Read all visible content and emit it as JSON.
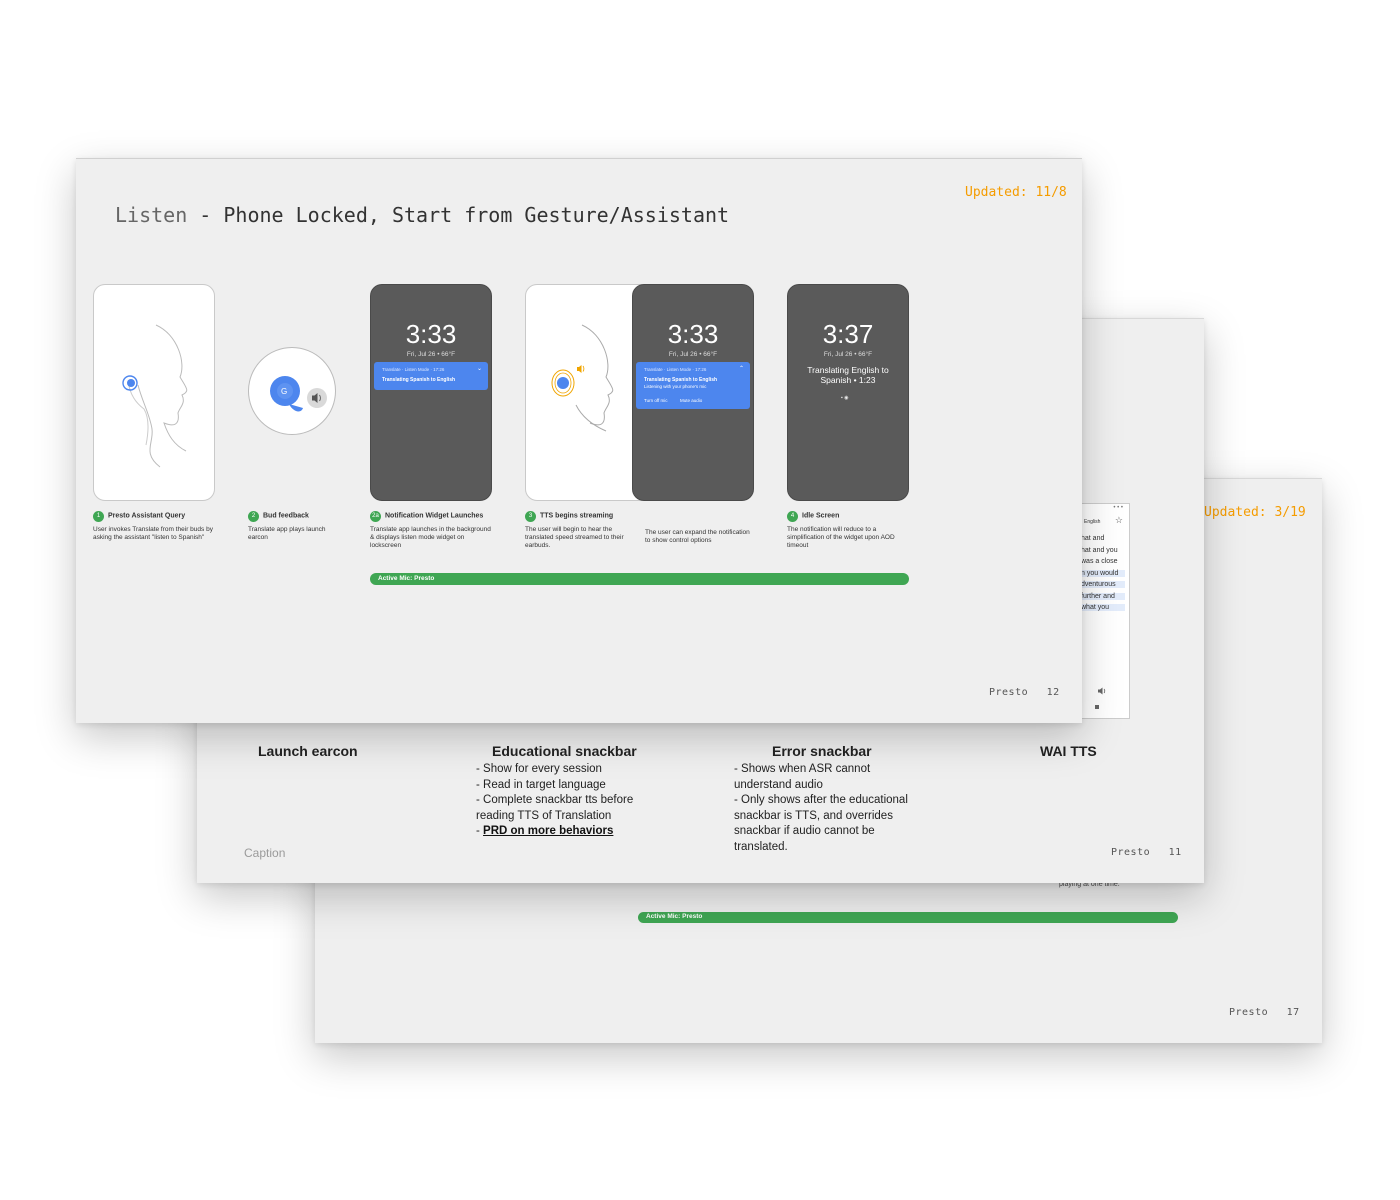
{
  "back_slide": {
    "updated": "Updated: 3/19",
    "note": "playing at one time.",
    "active_mic": "Active Mic: Presto",
    "footer_brand": "Presto",
    "footer_page": "17"
  },
  "middle_slide": {
    "phone_header": "English",
    "phone_lines": [
      "hat and",
      "hat and you",
      "was a close",
      "n you would",
      "dventurous",
      "further and",
      "what you"
    ],
    "columns": [
      {
        "title": "Launch earcon",
        "bullets": []
      },
      {
        "title": "Educational snackbar",
        "bullets": [
          "- Show for every session",
          "- Read in target language",
          "- Complete snackbar tts before reading TTS of Translation"
        ],
        "link_prefix": "- ",
        "link": "PRD on more behaviors"
      },
      {
        "title": "Error snackbar",
        "bullets": [
          "- Shows when ASR cannot understand audio",
          "- Only shows after the educational snackbar is TTS, and overrides snackbar if audio cannot be translated."
        ]
      },
      {
        "title": "WAI TTS",
        "bullets": []
      }
    ],
    "caption": "Caption",
    "footer_brand": "Presto",
    "footer_page": "11"
  },
  "front_slide": {
    "title_prefix": "Listen",
    "title_main": " - Phone Locked, Start from Gesture/Assistant",
    "updated": "Updated: 11/8",
    "phones": {
      "lock1": {
        "time": "3:33",
        "date": "Fri, Jul 26 • 66°F",
        "notif_app": "Translate · Listen Mode · 17:26",
        "notif_title": "Translating Spanish to English"
      },
      "lock2": {
        "time": "3:33",
        "date": "Fri, Jul 26 • 66°F",
        "notif_app": "Translate · Listen Mode · 17:26",
        "notif_title": "Translating Spanish to English",
        "notif_sub": "Listening with your phone's mic",
        "action1": "Turn off mic",
        "action2": "Mute audio"
      },
      "idle": {
        "time": "3:37",
        "date": "Fri, Jul 26 • 66°F",
        "status": "Translating English to Spanish • 1:23"
      }
    },
    "steps": [
      {
        "num": "1",
        "title": "Presto Assistant Query",
        "desc": "User invokes Translate from their buds by asking the assistant \"listen to Spanish\""
      },
      {
        "num": "2",
        "title": "Bud feedback",
        "desc": "Translate app plays launch earcon"
      },
      {
        "num": "2a",
        "title": "Notification Widget Launches",
        "desc": "Translate app launches in the background & displays listen mode widget on lockscreen"
      },
      {
        "num": "3",
        "title": "TTS begins streaming",
        "desc": "The user will begin to hear the translated speed streamed to their earbuds."
      },
      {
        "num": "",
        "title": "",
        "desc": "The user can expand the notification to show control options"
      },
      {
        "num": "4",
        "title": "Idle Screen",
        "desc": "The notification will reduce to a simplification of the widget upon AOD timeout"
      }
    ],
    "active_mic": "Active Mic: Presto",
    "footer_brand": "Presto",
    "footer_page": "12"
  },
  "icons": [
    "ear-gesture-icon",
    "earbud-icon",
    "speaker-icon",
    "star-icon",
    "translate-app-icon"
  ],
  "colors": {
    "accent_green": "#3fa653",
    "updated_orange": "#f59c00",
    "notif_blue": "#4d86ee",
    "lock_dark": "#5a5a5a"
  }
}
